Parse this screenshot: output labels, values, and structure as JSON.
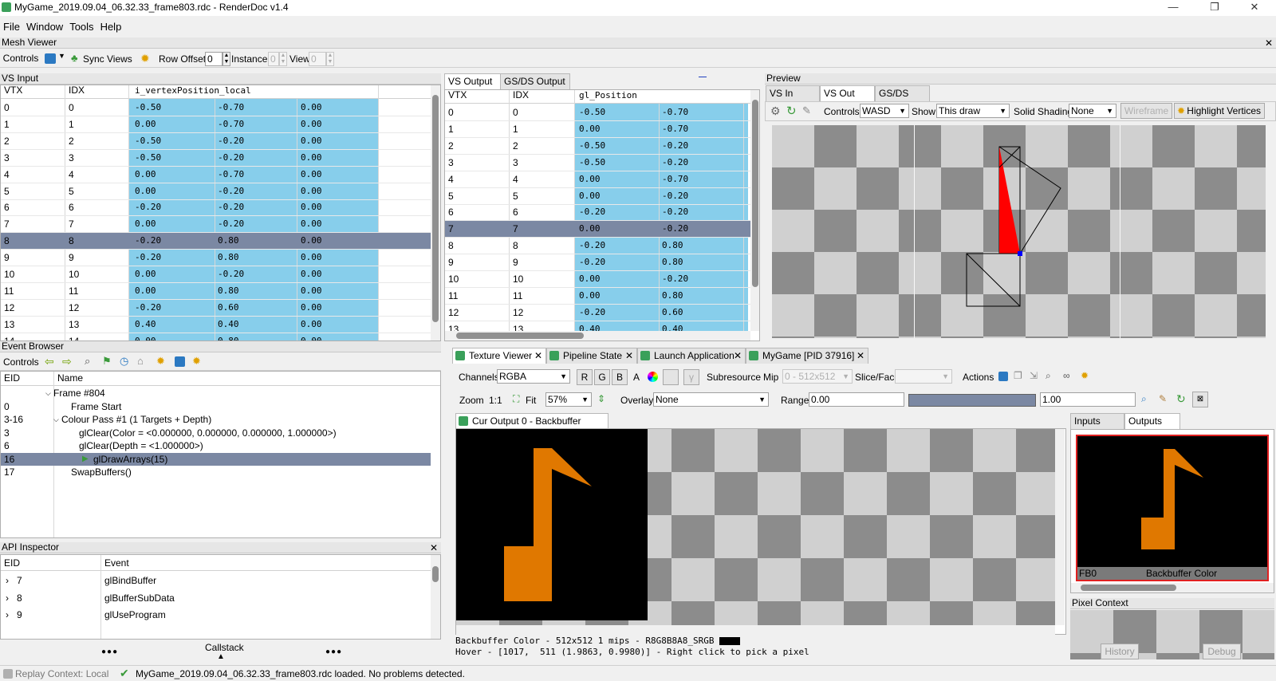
{
  "window": {
    "title": "MyGame_2019.09.04_06.32.33_frame803.rdc - RenderDoc v1.4",
    "min": "—",
    "restore": "❐",
    "close": "✕"
  },
  "menu": [
    "File",
    "Window",
    "Tools",
    "Help"
  ],
  "mesh_viewer": {
    "title": "Mesh Viewer",
    "toolbar": {
      "controls": "Controls",
      "sync_views": "Sync Views",
      "row_offset_label": "Row Offset",
      "row_offset": "0",
      "instance_label": "Instance",
      "instance": "0",
      "view_label": "View",
      "view": "0"
    },
    "vs_input": {
      "title": "VS Input",
      "headers": [
        "VTX",
        "IDX",
        "i_vertexPosition_local"
      ],
      "rows": [
        [
          "0",
          "0",
          "-0.50",
          "-0.70",
          "0.00"
        ],
        [
          "1",
          "1",
          "0.00",
          "-0.70",
          "0.00"
        ],
        [
          "2",
          "2",
          "-0.50",
          "-0.20",
          "0.00"
        ],
        [
          "3",
          "3",
          "-0.50",
          "-0.20",
          "0.00"
        ],
        [
          "4",
          "4",
          "0.00",
          "-0.70",
          "0.00"
        ],
        [
          "5",
          "5",
          "0.00",
          "-0.20",
          "0.00"
        ],
        [
          "6",
          "6",
          "-0.20",
          "-0.20",
          "0.00"
        ],
        [
          "7",
          "7",
          "0.00",
          "-0.20",
          "0.00"
        ],
        [
          "8",
          "8",
          "-0.20",
          "0.80",
          "0.00"
        ],
        [
          "9",
          "9",
          "-0.20",
          "0.80",
          "0.00"
        ],
        [
          "10",
          "10",
          "0.00",
          "-0.20",
          "0.00"
        ],
        [
          "11",
          "11",
          "0.00",
          "0.80",
          "0.00"
        ],
        [
          "12",
          "12",
          "-0.20",
          "0.60",
          "0.00"
        ],
        [
          "13",
          "13",
          "0.40",
          "0.40",
          "0.00"
        ],
        [
          "14",
          "14",
          "0.00",
          "0.80",
          "0.00"
        ]
      ]
    },
    "vs_output": {
      "tabs": [
        "VS Output",
        "GS/DS Output"
      ],
      "headers": [
        "VTX",
        "IDX",
        "gl_Position"
      ],
      "rows": [
        [
          "0",
          "0",
          "-0.50",
          "-0.70"
        ],
        [
          "1",
          "1",
          "0.00",
          "-0.70"
        ],
        [
          "2",
          "2",
          "-0.50",
          "-0.20"
        ],
        [
          "3",
          "3",
          "-0.50",
          "-0.20"
        ],
        [
          "4",
          "4",
          "0.00",
          "-0.70"
        ],
        [
          "5",
          "5",
          "0.00",
          "-0.20"
        ],
        [
          "6",
          "6",
          "-0.20",
          "-0.20"
        ],
        [
          "7",
          "7",
          "0.00",
          "-0.20"
        ],
        [
          "8",
          "8",
          "-0.20",
          "0.80"
        ],
        [
          "9",
          "9",
          "-0.20",
          "0.80"
        ],
        [
          "10",
          "10",
          "0.00",
          "-0.20"
        ],
        [
          "11",
          "11",
          "0.00",
          "0.80"
        ],
        [
          "12",
          "12",
          "-0.20",
          "0.60"
        ],
        [
          "13",
          "13",
          "0.40",
          "0.40"
        ]
      ]
    },
    "preview": {
      "title": "Preview",
      "tabs": [
        "VS In",
        "VS Out",
        "GS/DS Out"
      ],
      "controls_label": "Controls",
      "controls": "WASD",
      "show_label": "Show",
      "show": "This draw",
      "solid_label": "Solid Shading",
      "solid": "None",
      "wireframe": "Wireframe",
      "highlight": "Highlight Vertices"
    }
  },
  "event_browser": {
    "title": "Event Browser",
    "controls": "Controls",
    "headers": [
      "EID",
      "Name"
    ],
    "events": [
      {
        "eid": "",
        "name": "Frame #804"
      },
      {
        "eid": "0",
        "name": "Frame Start"
      },
      {
        "eid": "3-16",
        "name": "Colour Pass #1 (1 Targets + Depth)"
      },
      {
        "eid": "3",
        "name": "glClear(Color = <0.000000, 0.000000, 0.000000, 1.000000>)"
      },
      {
        "eid": "6",
        "name": "glClear(Depth = <1.000000>)"
      },
      {
        "eid": "16",
        "name": "glDrawArrays(15)"
      },
      {
        "eid": "17",
        "name": "SwapBuffers()"
      }
    ]
  },
  "api_inspector": {
    "title": "API Inspector",
    "headers": [
      "EID",
      "Event"
    ],
    "rows": [
      [
        "7",
        "glBindBuffer"
      ],
      [
        "8",
        "glBufferSubData"
      ],
      [
        "9",
        "glUseProgram"
      ]
    ],
    "callstack": "Callstack",
    "dots": "●●●"
  },
  "texture_viewer": {
    "tabs": [
      "Texture Viewer",
      "Pipeline State",
      "Launch Application",
      "MyGame [PID 37916]"
    ],
    "channels_label": "Channels",
    "channels": "RGBA",
    "r": "R",
    "g": "G",
    "b": "B",
    "a": "A",
    "subresource": "Subresource",
    "mip_label": "Mip",
    "mip": "0 - 512x512",
    "slice_label": "Slice/Face",
    "actions": "Actions",
    "zoom_label": "Zoom",
    "zoom_1to1": "1:1",
    "fit": "Fit",
    "zoom": "57%",
    "overlay_label": "Overlay",
    "overlay": "None",
    "range_label": "Range",
    "range_min": "0.00",
    "range_max": "1.00",
    "output_tab": "Cur Output 0 - Backbuffer Color",
    "status1": "Backbuffer Color - 512x512 1 mips - R8G8B8A8_SRGB",
    "status2": "Hover - [1017,  511 (1.9863, 0.9980)] - Right click to pick a pixel",
    "io_tabs": [
      "Inputs",
      "Outputs"
    ],
    "thumb_label": "FB0",
    "thumb_name": "Backbuffer Color",
    "pixel_context": "Pixel Context",
    "history": "History",
    "debug": "Debug"
  },
  "status": {
    "replay": "Replay Context: Local",
    "message": "MyGame_2019.09.04_06.32.33_frame803.rdc loaded. No problems detected."
  },
  "colors": {
    "selection": "#7b88a3",
    "data_blue": "#87ceeb",
    "note_orange": "#e07800",
    "triangle_red": "#ff0000"
  }
}
